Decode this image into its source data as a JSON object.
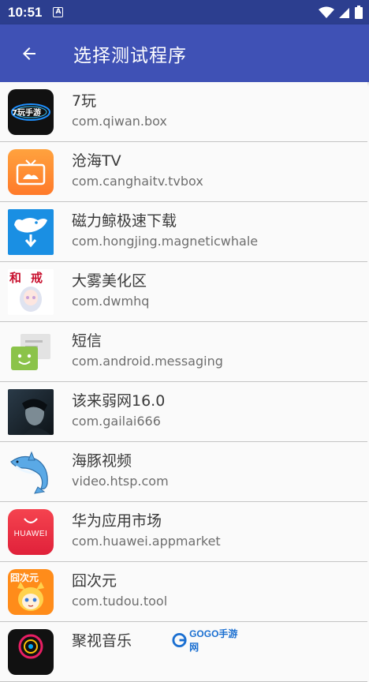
{
  "status": {
    "time": "10:51",
    "a_label": "A"
  },
  "header": {
    "title": "选择测试程序"
  },
  "apps": [
    {
      "name": "7玩",
      "package": "com.qiwan.box",
      "icon": "7wan-icon",
      "icon_text": "7玩手游"
    },
    {
      "name": "沧海TV",
      "package": "com.canghaitv.tvbox",
      "icon": "tv-icon"
    },
    {
      "name": "磁力鲸极速下载",
      "package": "com.hongjing.magneticwhale",
      "icon": "whale-icon"
    },
    {
      "name": "大雾美化区",
      "package": "com.dwmhq",
      "icon": "anime-girl-icon",
      "icon_text": "和戒"
    },
    {
      "name": "短信",
      "package": "com.android.messaging",
      "icon": "messaging-icon"
    },
    {
      "name": "该来弱网16.0",
      "package": "com.gailai666",
      "icon": "dark-portrait-icon"
    },
    {
      "name": "海豚视频",
      "package": "video.htsp.com",
      "icon": "dolphin-icon"
    },
    {
      "name": "华为应用市场",
      "package": "com.huawei.appmarket",
      "icon": "huawei-icon",
      "icon_text": "HUAWEI"
    },
    {
      "name": "囧次元",
      "package": "com.tudou.tool",
      "icon": "jiong-icon",
      "icon_text": "囧次元"
    },
    {
      "name": "聚视音乐",
      "package": "",
      "icon": "music-icon"
    }
  ],
  "watermark": {
    "text": "GOGO手游网"
  },
  "colors": {
    "status_bar": "#2c3e8f",
    "app_bar": "#3f51b5"
  }
}
